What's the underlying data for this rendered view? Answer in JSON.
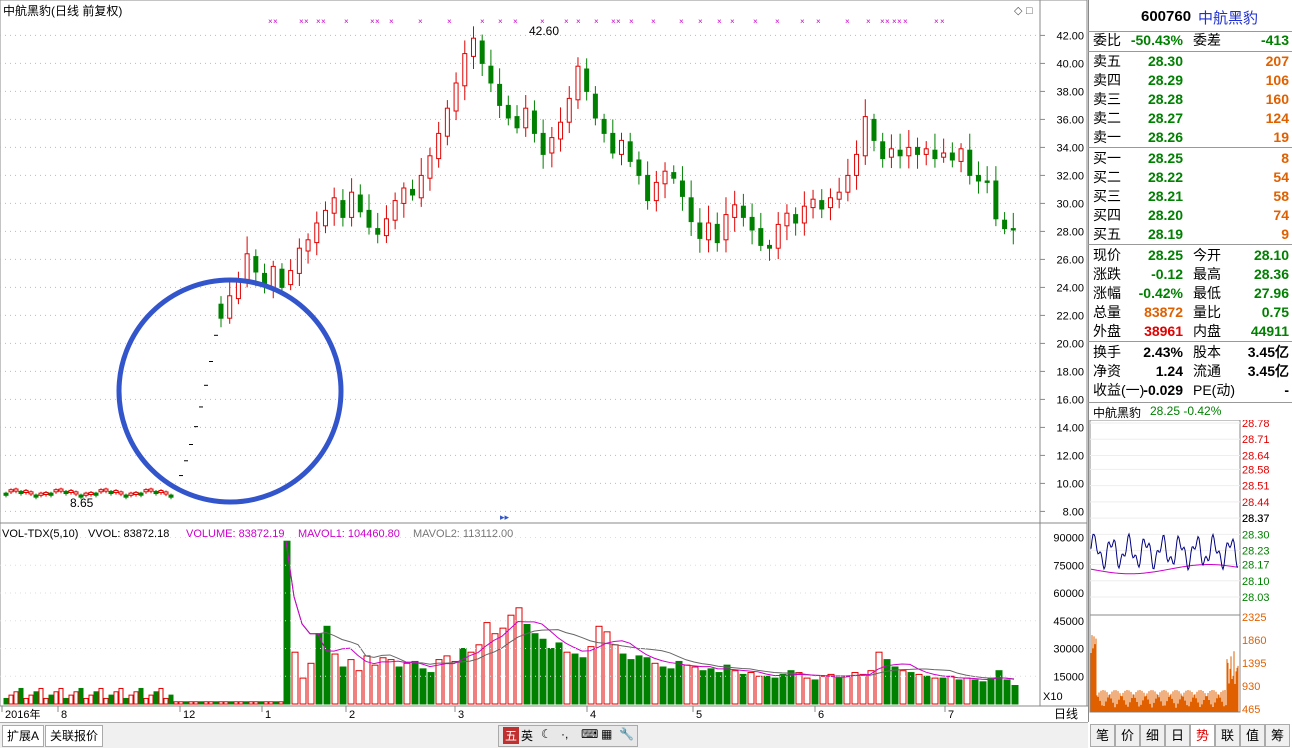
{
  "chart_title": "中航黑豹(日线 前复权)",
  "chart_annotations": {
    "high_label": "42.60",
    "low_label": "8.65"
  },
  "price_axis": {
    "ticks": [
      "42.00",
      "40.00",
      "38.00",
      "36.00",
      "34.00",
      "32.00",
      "30.00",
      "28.00",
      "26.00",
      "24.00",
      "22.00",
      "20.00",
      "18.00",
      "16.00",
      "14.00",
      "12.00",
      "10.00",
      "8.00"
    ]
  },
  "volume_header": {
    "indicator": "VOL-TDX(5,10)",
    "vvol": "VVOL: 83872.18",
    "volume": "VOLUME: 83872.19",
    "mavol1": "MAVOL1: 104460.80",
    "mavol2": "MAVOL2: 113112.00"
  },
  "volume_axis": {
    "ticks": [
      "90000",
      "75000",
      "60000",
      "45000",
      "30000",
      "15000"
    ],
    "unit": "X10"
  },
  "date_axis": {
    "labels": [
      "2016年",
      "8",
      "12",
      "1",
      "2",
      "3",
      "4",
      "5",
      "6",
      "7"
    ]
  },
  "bottom_tabs": [
    "扩展A",
    "关联报价"
  ],
  "bottom_toolbar": {
    "items": [
      "五",
      "英"
    ]
  },
  "period_label": "日线",
  "quote": {
    "code": "600760",
    "name": "中航黑豹",
    "weibi_label": "委比",
    "weibi_value": "-50.43%",
    "weicha_label": "委差",
    "weicha_value": "-413",
    "asks": [
      {
        "label": "卖五",
        "price": "28.30",
        "vol": "207"
      },
      {
        "label": "卖四",
        "price": "28.29",
        "vol": "106"
      },
      {
        "label": "卖三",
        "price": "28.28",
        "vol": "160"
      },
      {
        "label": "卖二",
        "price": "28.27",
        "vol": "124"
      },
      {
        "label": "卖一",
        "price": "28.26",
        "vol": "19"
      }
    ],
    "bids": [
      {
        "label": "买一",
        "price": "28.25",
        "vol": "8"
      },
      {
        "label": "买二",
        "price": "28.22",
        "vol": "54"
      },
      {
        "label": "买三",
        "price": "28.21",
        "vol": "58"
      },
      {
        "label": "买四",
        "price": "28.20",
        "vol": "74"
      },
      {
        "label": "买五",
        "price": "28.19",
        "vol": "9"
      }
    ],
    "stats": [
      {
        "l1": "现价",
        "v1": "28.25",
        "c1": "grn",
        "l2": "今开",
        "v2": "28.10",
        "c2": "grn"
      },
      {
        "l1": "涨跌",
        "v1": "-0.12",
        "c1": "grn",
        "l2": "最高",
        "v2": "28.36",
        "c2": "grn"
      },
      {
        "l1": "涨幅",
        "v1": "-0.42%",
        "c1": "grn",
        "l2": "最低",
        "v2": "27.96",
        "c2": "grn"
      },
      {
        "l1": "总量",
        "v1": "83872",
        "c1": "org",
        "l2": "量比",
        "v2": "0.75",
        "c2": "grn"
      },
      {
        "l1": "外盘",
        "v1": "38961",
        "c1": "red",
        "l2": "内盘",
        "v2": "44911",
        "c2": "grn"
      }
    ],
    "stats2": [
      {
        "l1": "换手",
        "v1": "2.43%",
        "l2": "股本",
        "v2": "3.45亿"
      },
      {
        "l1": "净资",
        "v1": "1.24",
        "l2": "流通",
        "v2": "3.45亿"
      },
      {
        "l1": "收益(一)",
        "v1": "-0.029",
        "l2": "PE(动)",
        "v2": "-"
      }
    ]
  },
  "mini_chart": {
    "header_name": "中航黑豹",
    "header_value": "28.25 -0.42%",
    "price_ticks": [
      "28.78",
      "28.71",
      "28.64",
      "28.58",
      "28.51",
      "28.44",
      "28.37",
      "28.30",
      "28.23",
      "28.17",
      "28.10",
      "28.03"
    ],
    "vol_ticks": [
      "2325",
      "1860",
      "1395",
      "930",
      "465"
    ]
  },
  "right_tabs": [
    "笔",
    "价",
    "细",
    "日",
    "势",
    "联",
    "值",
    "筹"
  ],
  "colors": {
    "up": "#e00000",
    "down": "#008000",
    "ma1": "#cc00cc",
    "ma2": "#666666",
    "circle": "#3355cc",
    "minute_line": "#000080",
    "avg_line": "#cc00cc",
    "minute_vol": "#e06000"
  }
}
